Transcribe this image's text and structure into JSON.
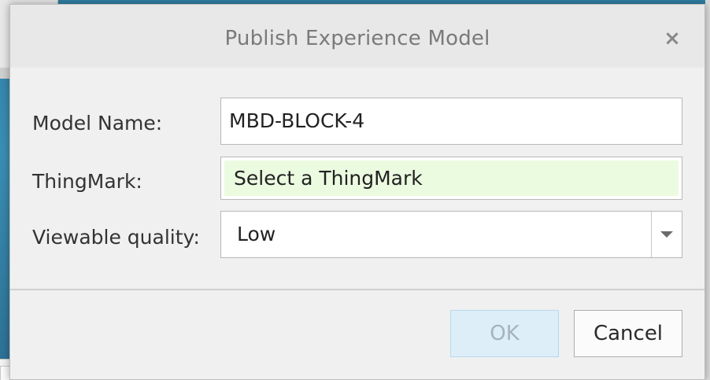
{
  "dialog": {
    "title": "Publish Experience Model",
    "close_glyph": "×"
  },
  "form": {
    "model_name": {
      "label": "Model Name:",
      "value": "MBD-BLOCK-4"
    },
    "thingmark": {
      "label": "ThingMark:",
      "value": "Select a ThingMark",
      "highlight_color": "#ebfbe0"
    },
    "viewable_quality": {
      "label": "Viewable quality:",
      "selected": "Low"
    }
  },
  "buttons": {
    "ok_label": "OK",
    "cancel_label": "Cancel"
  },
  "icons": {
    "close": "close-icon",
    "dropdown": "chevron-down-icon"
  }
}
